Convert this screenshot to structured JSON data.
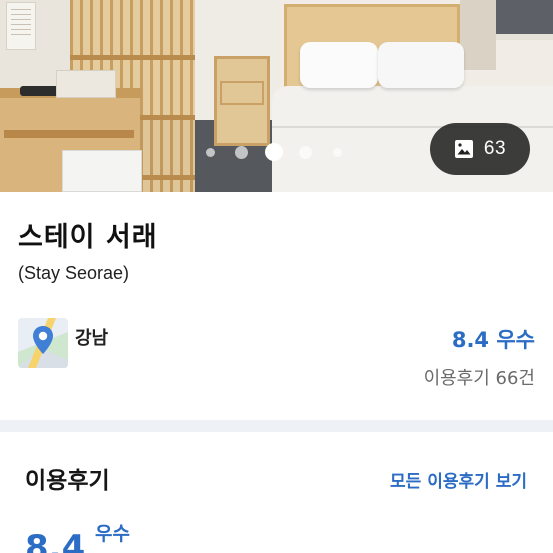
{
  "hero": {
    "carousel": {
      "dot_count": 5,
      "active_index": 2
    },
    "photo_count": "63",
    "icon": "image-gallery-icon"
  },
  "hotel": {
    "name": "스테이 서래",
    "english_name": "(Stay Seorae)",
    "location": "강남",
    "location_icon": "map-pin-icon",
    "rating": "8.4 우수",
    "review_count": "이용후기 66건"
  },
  "reviews": {
    "heading": "이용후기",
    "see_all_label": "모든 이용후기 보기",
    "score": "8.4",
    "grade": "우수"
  },
  "colors": {
    "accent": "#2b6cc4",
    "section_divider": "#eef1f5",
    "pill_background": "#222222"
  }
}
